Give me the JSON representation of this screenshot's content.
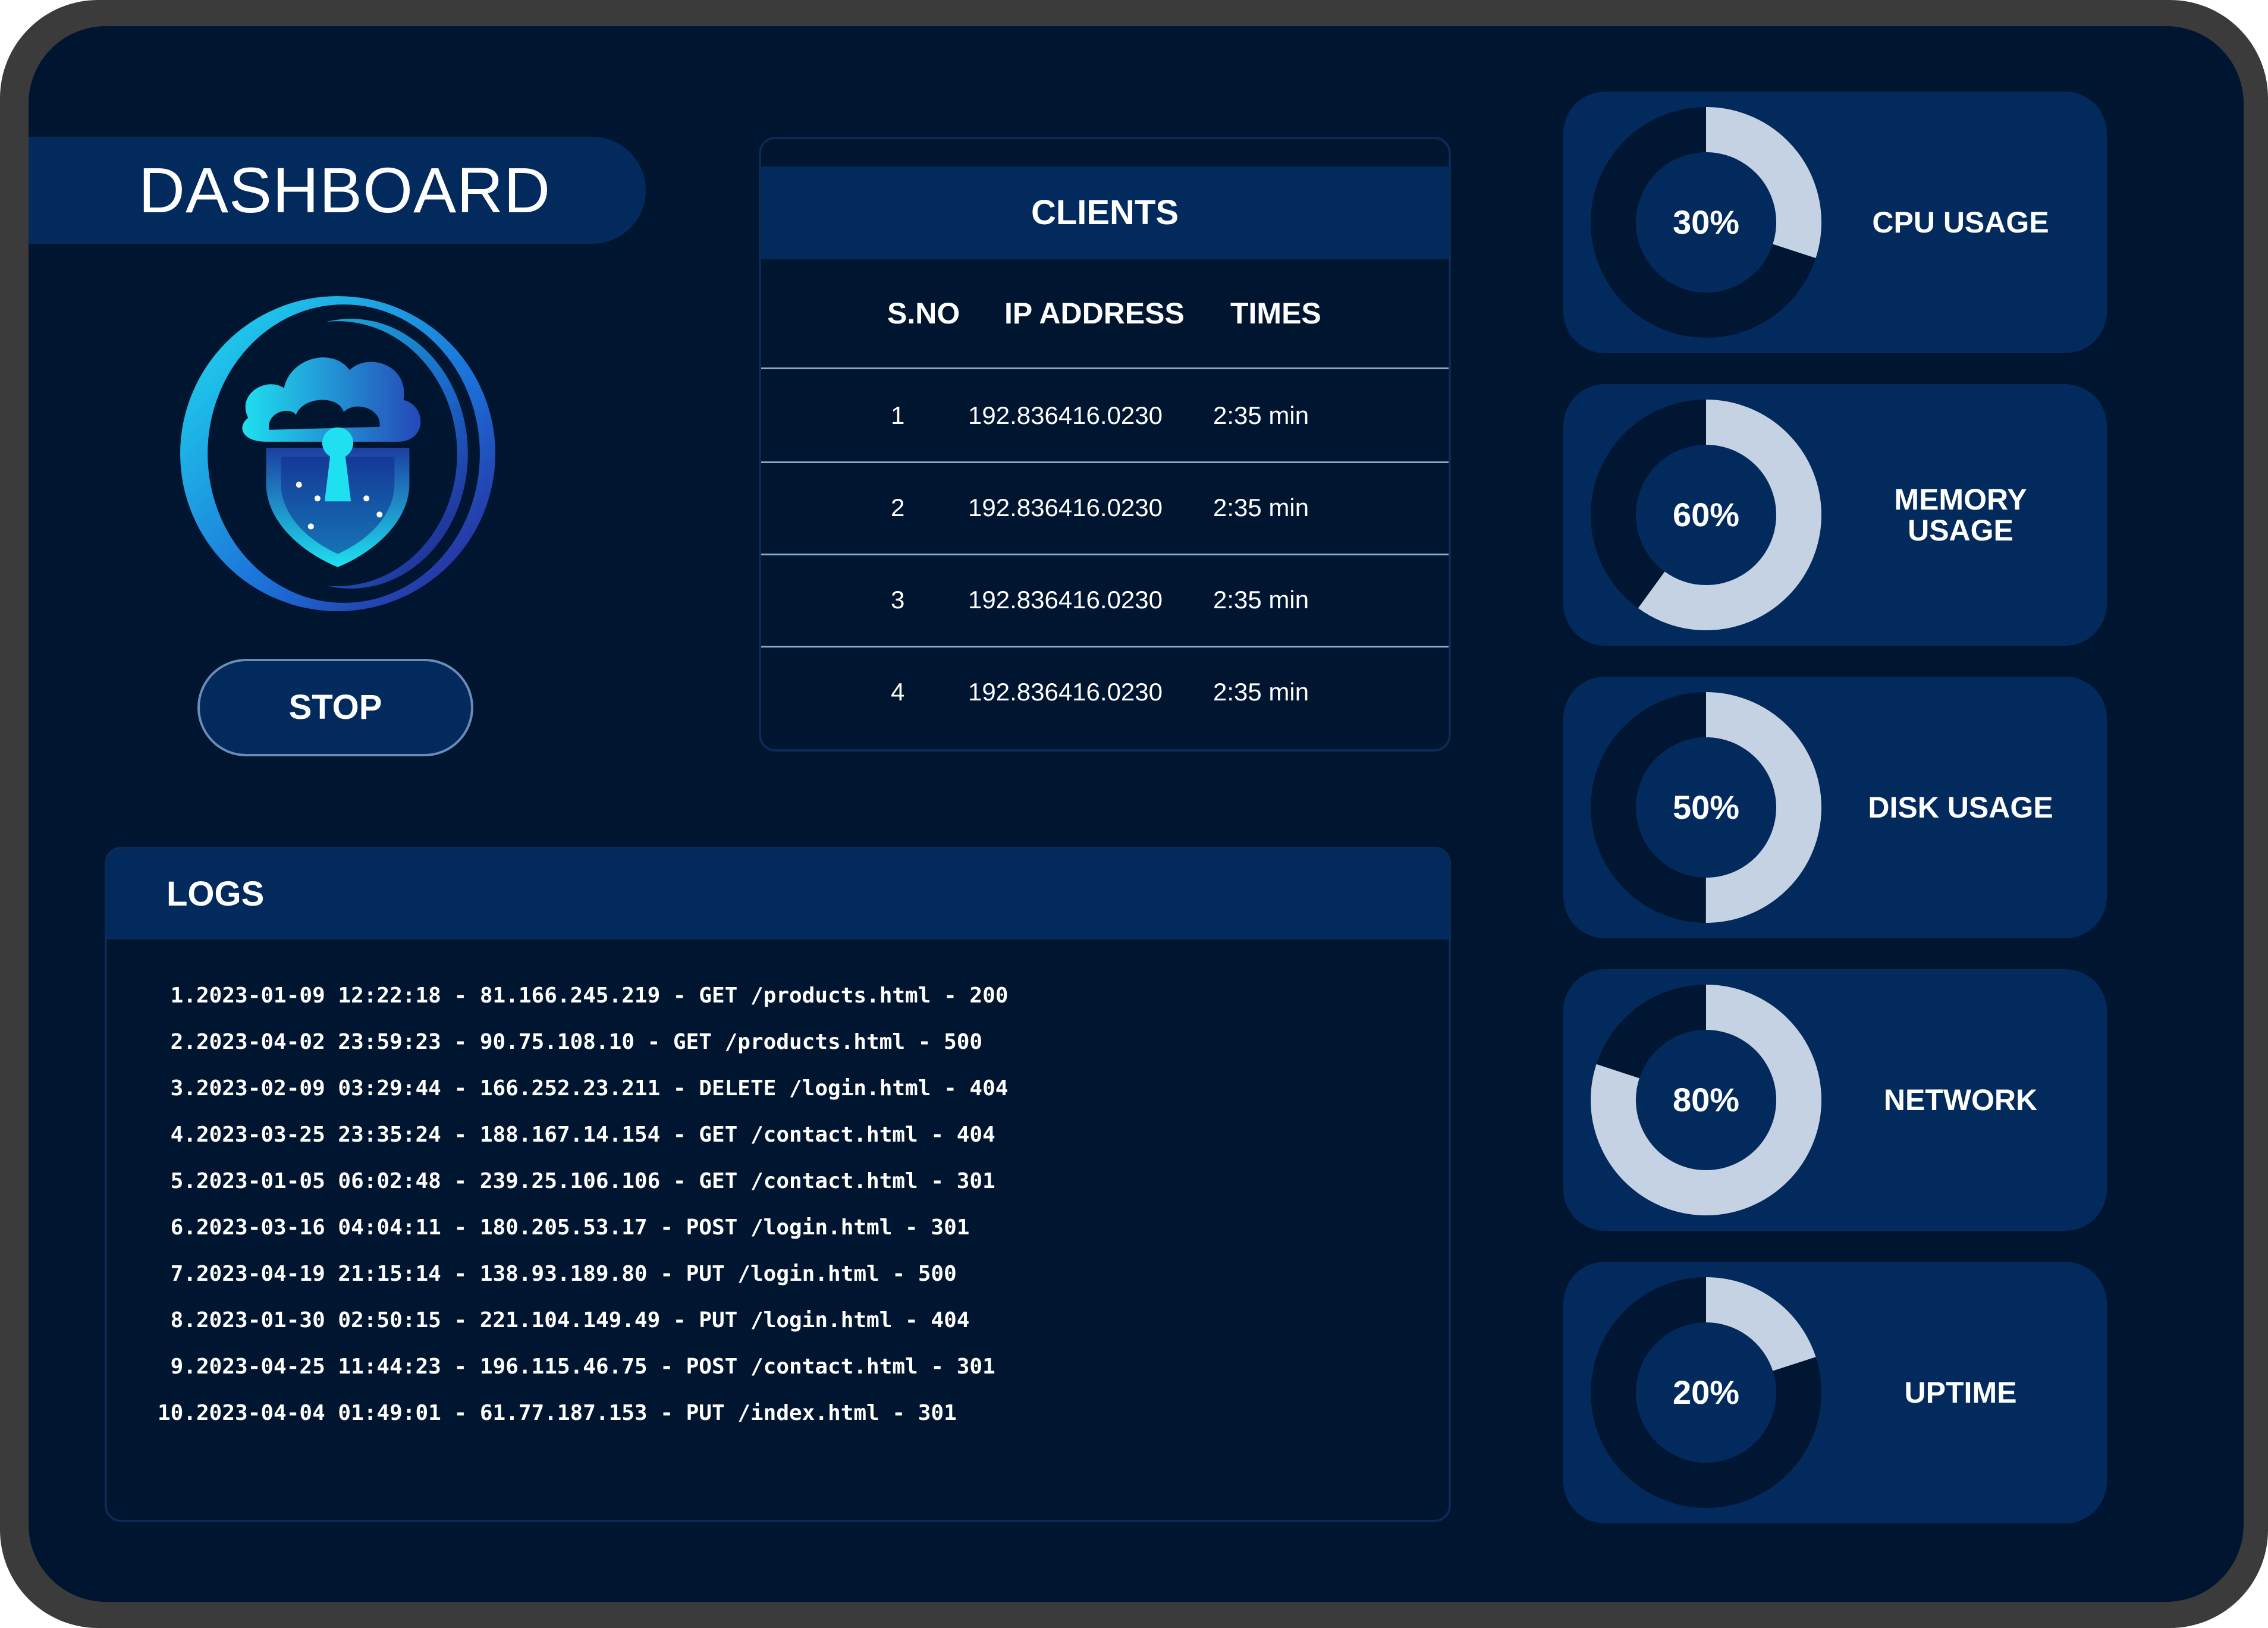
{
  "header": {
    "title": "DASHBOARD"
  },
  "controls": {
    "stop_label": "STOP"
  },
  "clients": {
    "title": "CLIENTS",
    "columns": [
      "S.NO",
      "IP ADDRESS",
      "TIMES"
    ],
    "rows": [
      [
        "1",
        "192.836416.0230",
        "2:35 min"
      ],
      [
        "2",
        "192.836416.0230",
        "2:35 min"
      ],
      [
        "3",
        "192.836416.0230",
        "2:35 min"
      ],
      [
        "4",
        "192.836416.0230",
        "2:35 min"
      ]
    ]
  },
  "logs": {
    "title": "LOGS",
    "entries": [
      "2023-01-09 12:22:18 - 81.166.245.219 - GET /products.html - 200",
      "2023-04-02 23:59:23 - 90.75.108.10 - GET /products.html - 500",
      "2023-02-09 03:29:44 - 166.252.23.211 - DELETE /login.html - 404",
      "2023-03-25 23:35:24 - 188.167.14.154 - GET /contact.html - 404",
      "2023-01-05 06:02:48 - 239.25.106.106 - GET /contact.html - 301",
      "2023-03-16 04:04:11 - 180.205.53.17 - POST /login.html - 301",
      "2023-04-19 21:15:14 - 138.93.189.80 - PUT /login.html - 500",
      "2023-01-30 02:50:15 - 221.104.149.49 - PUT /login.html - 404",
      "2023-04-25 11:44:23 - 196.115.46.75 - POST /contact.html - 301",
      "2023-04-04 01:49:01 - 61.77.187.153 - PUT /index.html - 301"
    ]
  },
  "gauges": [
    {
      "name": "cpu-usage",
      "label": "CPU USAGE",
      "percent_text": "30%",
      "value": 30
    },
    {
      "name": "memory-usage",
      "label": "MEMORY\nUSAGE",
      "percent_text": "60%",
      "value": 60
    },
    {
      "name": "disk-usage",
      "label": "DISK USAGE",
      "percent_text": "50%",
      "value": 50
    },
    {
      "name": "network",
      "label": "NETWORK",
      "percent_text": "80%",
      "value": 80
    },
    {
      "name": "uptime",
      "label": "UPTIME",
      "percent_text": "20%",
      "value": 20
    }
  ],
  "colors": {
    "screen_bg": "#00152f",
    "panel": "#022a5d",
    "gauge_fill": "#c5d2e3",
    "gauge_track": "#001632",
    "logo_cyan": "#1fe0f0"
  },
  "icons": {
    "logo": "cloud-shield-keyhole-icon"
  }
}
